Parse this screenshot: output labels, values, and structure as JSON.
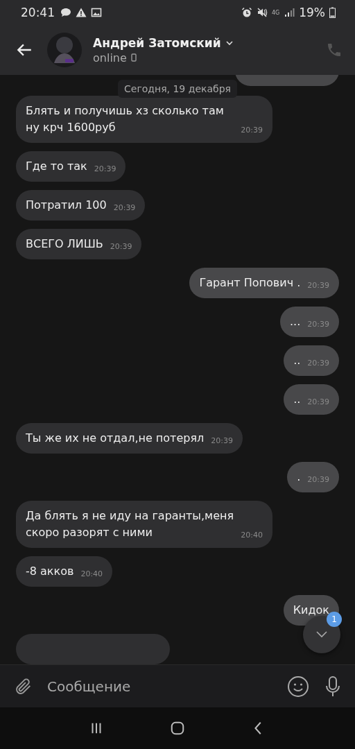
{
  "status_bar": {
    "time": "20:41",
    "network": "4G",
    "battery": "19%"
  },
  "header": {
    "name": "Андрей Затомский",
    "status": "online"
  },
  "date_divider": "Сегодня, 19 декабря",
  "messages": [
    {
      "kind": "partial",
      "outgoing": true
    },
    {
      "kind": "text",
      "outgoing": false,
      "text": "Блять и получишь хз сколько там ну крч 1600руб",
      "time": "20:39"
    },
    {
      "kind": "text",
      "outgoing": false,
      "text": "Где то так",
      "time": "20:39"
    },
    {
      "kind": "text",
      "outgoing": false,
      "text": "Потратил 100",
      "time": "20:39"
    },
    {
      "kind": "text",
      "outgoing": false,
      "text": "ВСЕГО ЛИШЬ",
      "time": "20:39"
    },
    {
      "kind": "text",
      "outgoing": true,
      "text": "Гарант Попович .",
      "time": "20:39"
    },
    {
      "kind": "text",
      "outgoing": true,
      "text": "...",
      "time": "20:39"
    },
    {
      "kind": "text",
      "outgoing": true,
      "text": "..",
      "time": "20:39"
    },
    {
      "kind": "text",
      "outgoing": true,
      "text": "..",
      "time": "20:39"
    },
    {
      "kind": "text",
      "outgoing": false,
      "text": "Ты же их не отдал,не потерял",
      "time": "20:39"
    },
    {
      "kind": "text",
      "outgoing": true,
      "text": ".",
      "time": "20:39"
    },
    {
      "kind": "text",
      "outgoing": false,
      "text": "Да блять я не иду на гаранты,меня скоро разорят с ними",
      "time": "20:40"
    },
    {
      "kind": "text",
      "outgoing": false,
      "text": "-8 акков",
      "time": "20:40"
    },
    {
      "kind": "text",
      "outgoing": true,
      "text": "Кидок"
    },
    {
      "kind": "partial",
      "outgoing": false
    }
  ],
  "scroll_button": {
    "badge": "1"
  },
  "composer": {
    "placeholder": "Сообщение"
  }
}
